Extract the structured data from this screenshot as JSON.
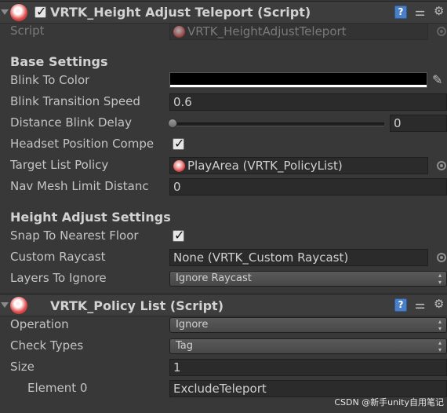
{
  "component1": {
    "title": "VRTK_Height Adjust Teleport (Script)",
    "enabled": true,
    "script_label": "Script",
    "script_value": "VRTK_HeightAdjustTeleport",
    "base_settings_title": "Base Settings",
    "blink_to_color_label": "Blink To Color",
    "blink_transition_speed_label": "Blink Transition Speed",
    "blink_transition_speed_value": "0.6",
    "distance_blink_delay_label": "Distance Blink Delay",
    "distance_blink_delay_value": "0",
    "distance_blink_delay_slider": 0,
    "headset_position_comp_label": "Headset Position Compe",
    "headset_position_comp_checked": true,
    "target_list_policy_label": "Target List Policy",
    "target_list_policy_value": "PlayArea (VRTK_PolicyList)",
    "nav_mesh_limit_label": "Nav Mesh Limit Distanc",
    "nav_mesh_limit_value": "0",
    "height_adjust_title": "Height Adjust Settings",
    "snap_to_floor_label": "Snap To Nearest Floor",
    "snap_to_floor_checked": true,
    "custom_raycast_label": "Custom Raycast",
    "custom_raycast_value": "None (VRTK_Custom Raycast)",
    "layers_to_ignore_label": "Layers To Ignore",
    "layers_to_ignore_value": "Ignore Raycast"
  },
  "component2": {
    "title": "VRTK_Policy List (Script)",
    "operation_label": "Operation",
    "operation_value": "Ignore",
    "check_types_label": "Check Types",
    "check_types_value": "Tag",
    "size_label": "Size",
    "size_value": "1",
    "element0_label": "Element 0",
    "element0_value": "ExcludeTeleport"
  },
  "header_icons": {
    "help": "help-book-icon",
    "presets": "sliders-icon",
    "settings": "gear-icon"
  },
  "colors": {
    "background": "#383838",
    "blink_color": "#000000"
  },
  "watermark": "CSDN @新手unity自用笔记"
}
